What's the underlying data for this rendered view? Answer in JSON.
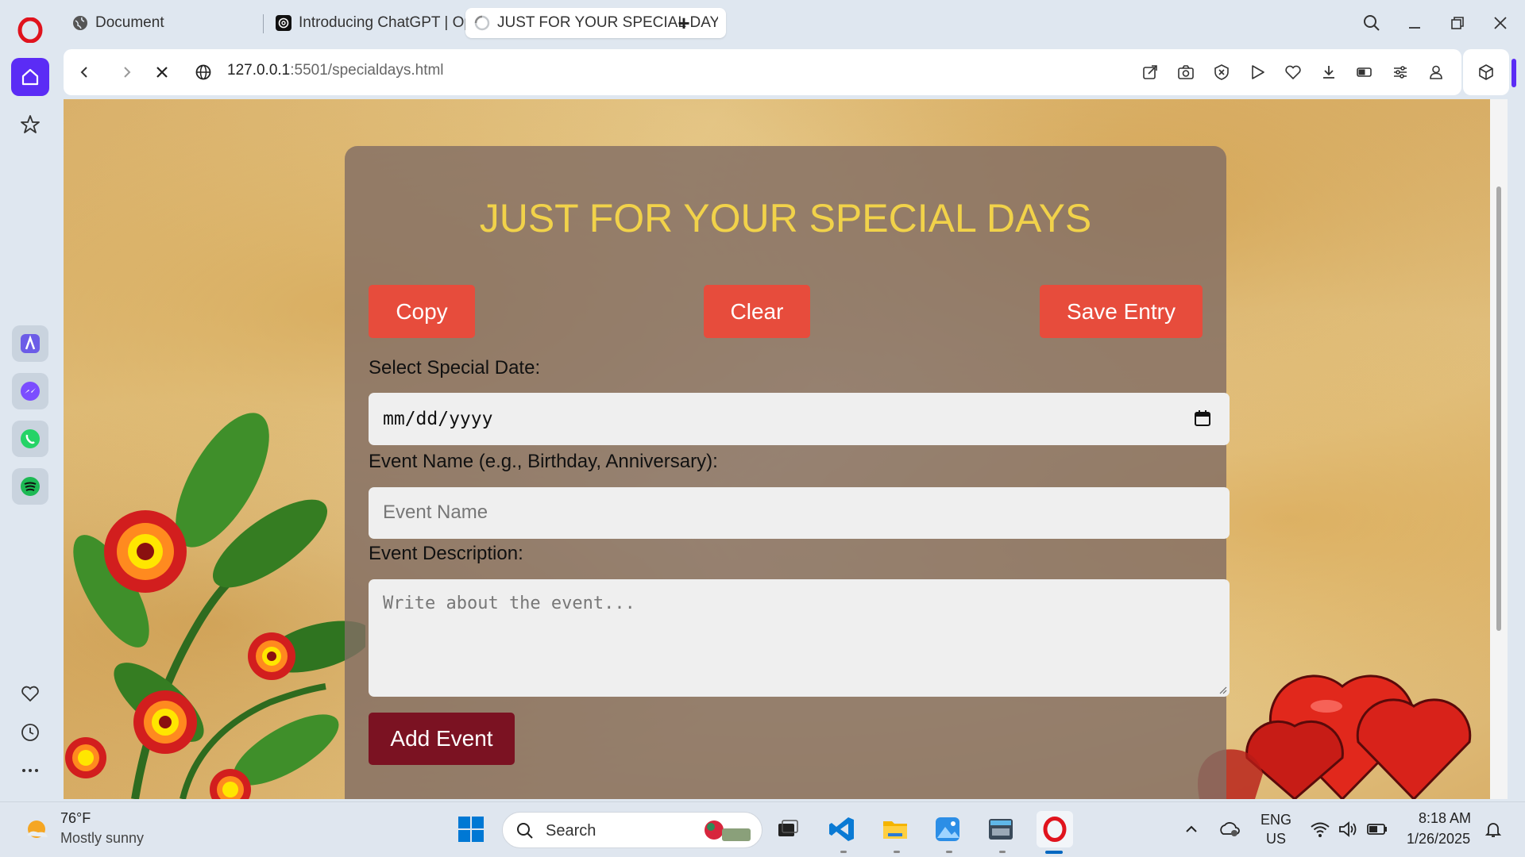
{
  "browser": {
    "tabs": [
      {
        "label": "Document",
        "icon": "globe-icon"
      },
      {
        "label": "Introducing ChatGPT | OpenAI",
        "icon": "openai-icon"
      },
      {
        "label": "JUST FOR YOUR SPECIAL DAYS",
        "icon": "loading-spinner-icon",
        "active": true
      }
    ],
    "url_host": "127.0.0.1",
    "url_rest": ":5501/specialdays.html",
    "new_tab_symbol": "+"
  },
  "page": {
    "title": "JUST FOR YOUR SPECIAL DAYS",
    "buttons": {
      "copy": "Copy",
      "clear": "Clear",
      "save": "Save Entry"
    },
    "date_label": "Select Special Date:",
    "date_placeholder": "mm/dd/yyyy",
    "event_name_label": "Event Name (e.g., Birthday, Anniversary):",
    "event_name_placeholder": "Event Name",
    "description_label": "Event Description:",
    "description_placeholder": "Write about the event...",
    "add_button": "Add Event"
  },
  "taskbar": {
    "temperature": "76°F",
    "weather": "Mostly sunny",
    "search": "Search",
    "lang": "ENG",
    "region": "US",
    "time": "8:18 AM",
    "date": "1/26/2025"
  },
  "colors": {
    "title": "#f1d24a",
    "button": "#e74c3c",
    "add_button": "#7b1222",
    "home_button": "#5b2cf5",
    "opera_red": "#e0131d"
  }
}
